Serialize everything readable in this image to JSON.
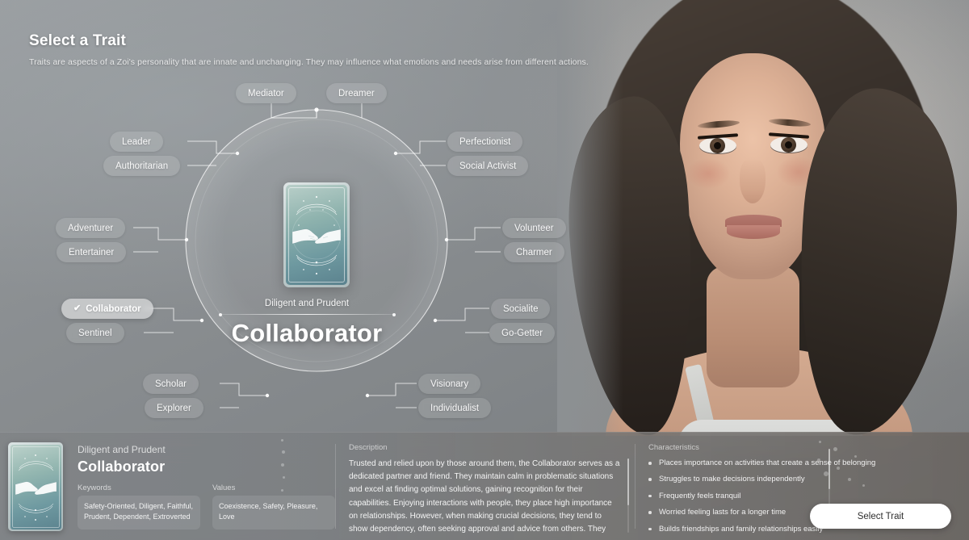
{
  "header": {
    "title": "Select a Trait",
    "subtitle": "Traits are aspects of a Zoi's personality that are innate and unchanging. They may influence what emotions and needs arise from different actions."
  },
  "wheel": {
    "selected_trait": "Collaborator",
    "check_glyph": "✔",
    "branches": [
      {
        "position": "top",
        "traits": [
          {
            "label": "Mediator"
          },
          {
            "label": "Dreamer"
          }
        ]
      },
      {
        "position": "upper-left",
        "traits": [
          {
            "label": "Leader"
          },
          {
            "label": "Authoritarian"
          }
        ]
      },
      {
        "position": "left",
        "traits": [
          {
            "label": "Adventurer"
          },
          {
            "label": "Entertainer"
          }
        ]
      },
      {
        "position": "lower-left",
        "traits": [
          {
            "label": "Collaborator"
          },
          {
            "label": "Sentinel"
          }
        ]
      },
      {
        "position": "bottom-left",
        "traits": [
          {
            "label": "Scholar"
          },
          {
            "label": "Explorer"
          }
        ]
      },
      {
        "position": "upper-right",
        "traits": [
          {
            "label": "Perfectionist"
          },
          {
            "label": "Social Activist"
          }
        ]
      },
      {
        "position": "right",
        "traits": [
          {
            "label": "Volunteer"
          },
          {
            "label": "Charmer"
          }
        ]
      },
      {
        "position": "lower-right",
        "traits": [
          {
            "label": "Socialite"
          },
          {
            "label": "Go-Getter"
          }
        ]
      },
      {
        "position": "bottom-right",
        "traits": [
          {
            "label": "Visionary"
          },
          {
            "label": "Individualist"
          }
        ]
      }
    ],
    "center": {
      "subtitle": "Diligent and Prudent",
      "name": "Collaborator",
      "card_art": "handshake-tarot-card"
    }
  },
  "detail_panel": {
    "card_art": "handshake-tarot-card",
    "subtitle": "Diligent and Prudent",
    "name": "Collaborator",
    "keywords_label": "Keywords",
    "keywords_value": "Safety-Oriented, Diligent, Faithful, Prudent, Dependent, Extroverted",
    "values_label": "Values",
    "values_value": "Coexistence, Safety, Pleasure, Love",
    "description_label": "Description",
    "description_text": "Trusted and relied upon by those around them, the Collaborator serves as a dedicated partner and friend. They maintain calm in problematic situations and excel at finding optimal solutions, gaining recognition for their capabilities. Enjoying interactions with people, they place high importance on relationships. However, when making crucial decisions, they tend to show dependency, often seeking approval and advice from others. They",
    "characteristics_label": "Characteristics",
    "characteristics": [
      "Places importance on activities that create a sense of belonging",
      "Struggles to make decisions independently",
      "Frequently feels tranquil",
      "Worried feeling lasts for a longer time",
      "Builds friendships and family relationships easily"
    ],
    "select_button_label": "Select Trait"
  },
  "colors": {
    "accent_white": "#ffffff",
    "card_teal": "#6e99a0",
    "panel_overlay": "rgba(124,127,130,0.80)"
  }
}
